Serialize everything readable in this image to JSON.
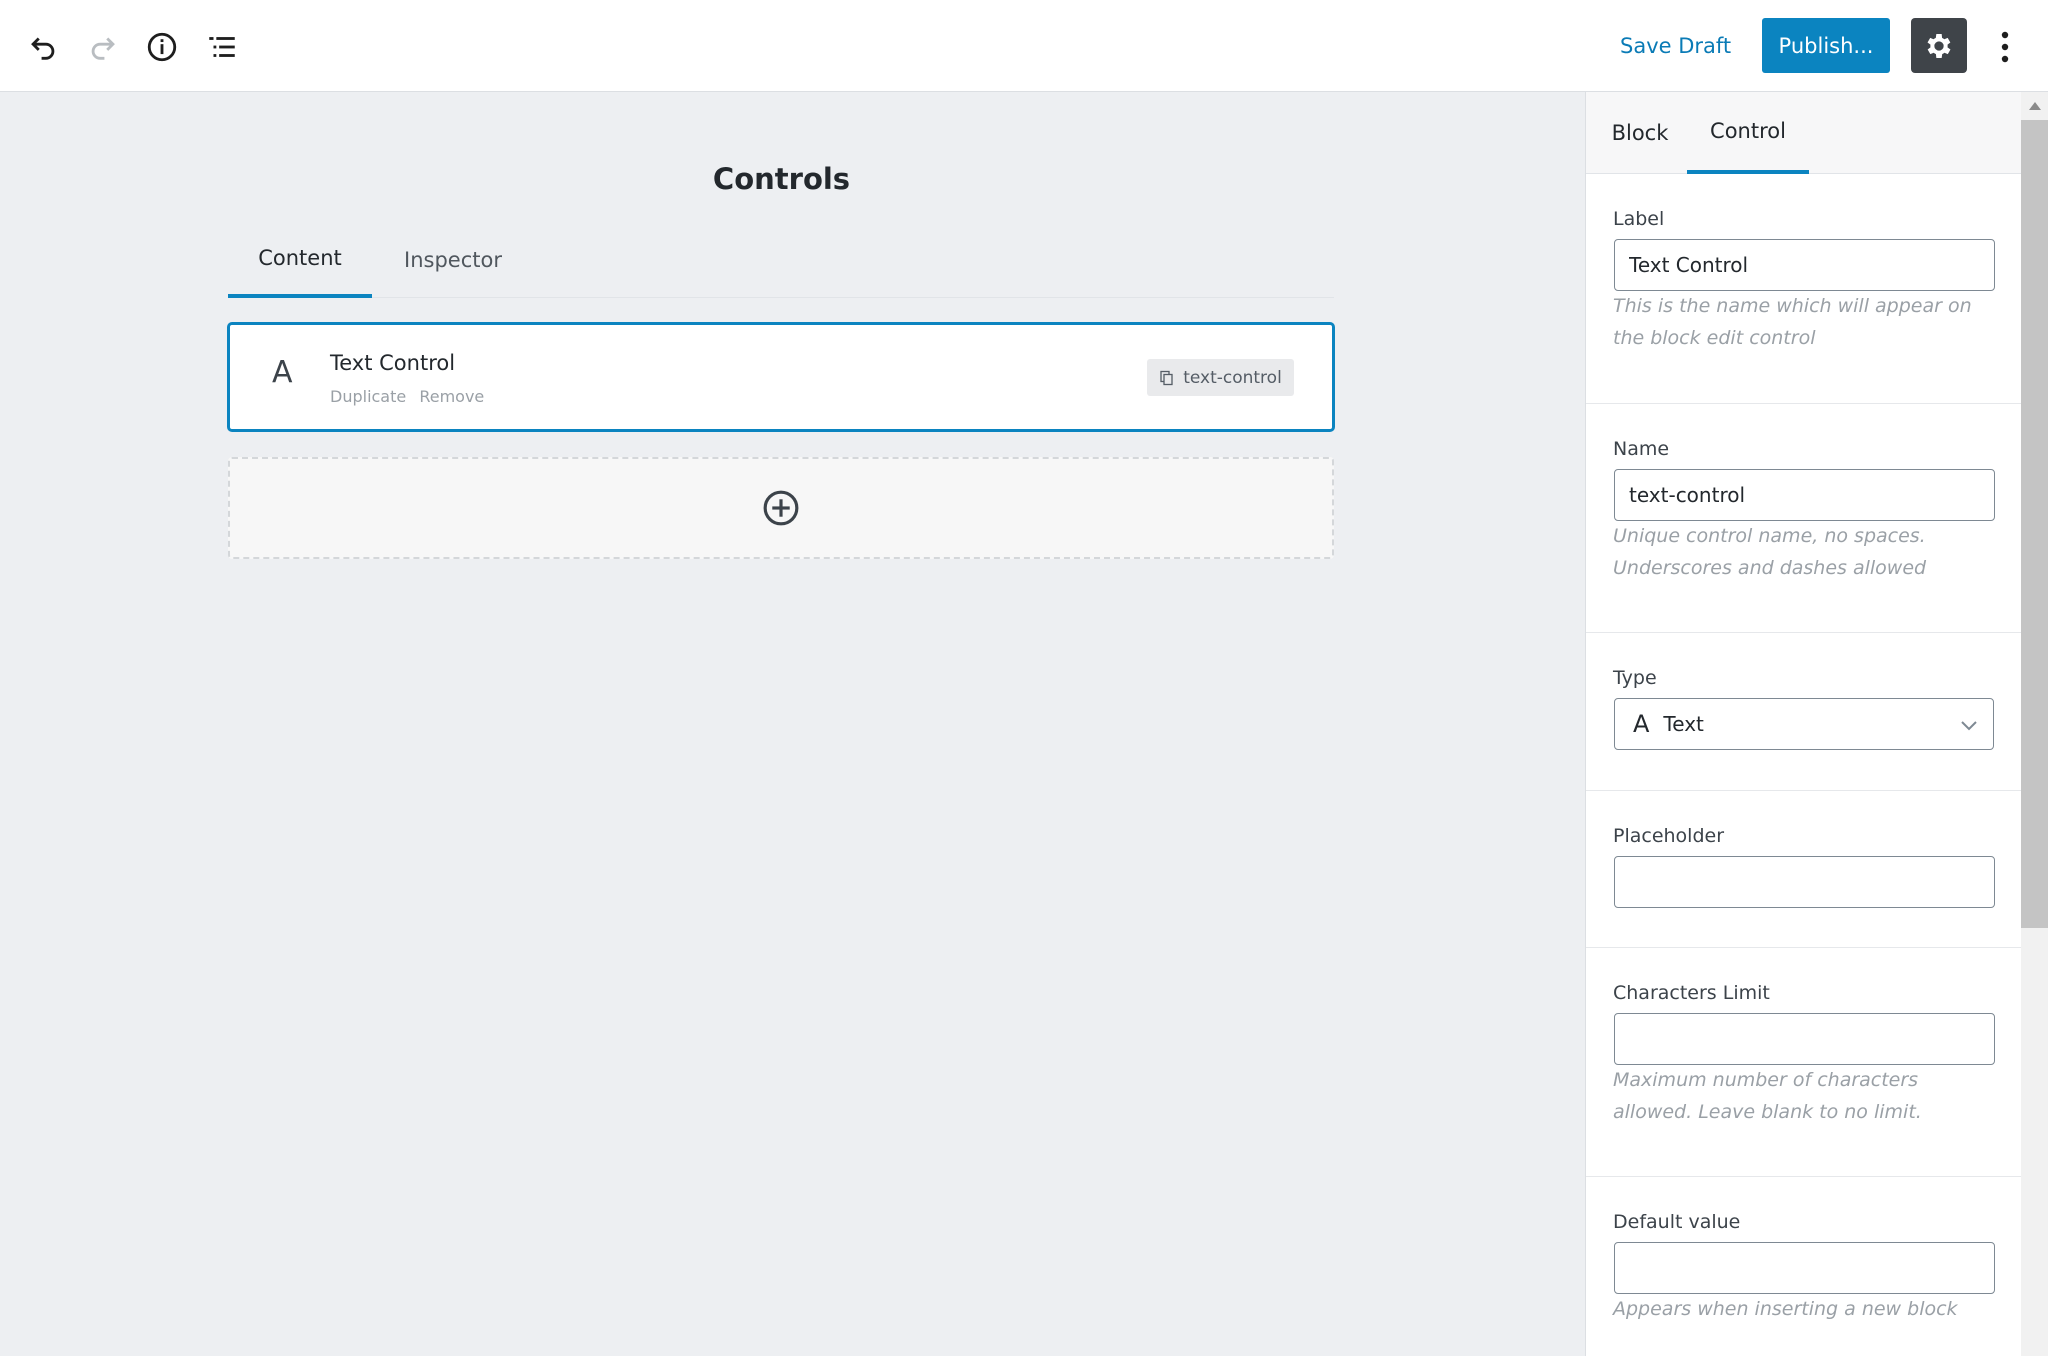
{
  "toolbar": {
    "undo_icon": "undo-icon",
    "redo_icon": "redo-icon",
    "info_icon": "info-icon",
    "outline_icon": "list-outline-icon",
    "save_draft_label": "Save Draft",
    "publish_label": "Publish...",
    "settings_icon": "gear-icon",
    "more_icon": "vertical-ellipsis-icon"
  },
  "editor": {
    "title": "Controls",
    "tabs": [
      {
        "label": "Content",
        "active": true
      },
      {
        "label": "Inspector",
        "active": false
      }
    ],
    "control": {
      "icon_glyph": "A",
      "title": "Text Control",
      "actions": [
        "Duplicate",
        "Remove"
      ],
      "slug": "text-control"
    },
    "add_icon": "plus-circle-icon"
  },
  "sidebar": {
    "tabs": [
      {
        "label": "Block",
        "active": false
      },
      {
        "label": "Control",
        "active": true
      }
    ],
    "fields": {
      "label": {
        "label": "Label",
        "value": "Text Control",
        "help": "This is the name which will appear on the block edit control"
      },
      "name": {
        "label": "Name",
        "value": "text-control",
        "help": "Unique control name, no spaces. Underscores and dashes allowed"
      },
      "type": {
        "label": "Type",
        "icon_glyph": "A",
        "value": "Text"
      },
      "placeholder": {
        "label": "Placeholder",
        "value": ""
      },
      "characters_limit": {
        "label": "Characters Limit",
        "value": "",
        "help": "Maximum number of characters allowed. Leave blank to no limit."
      },
      "default_value": {
        "label": "Default value",
        "value": "",
        "help": "Appears when inserting a new block"
      }
    }
  },
  "colors": {
    "accent": "#0b84c0",
    "link": "#0a7bb6",
    "settings_bg": "#3f4449",
    "editor_bg": "#edeff2"
  }
}
